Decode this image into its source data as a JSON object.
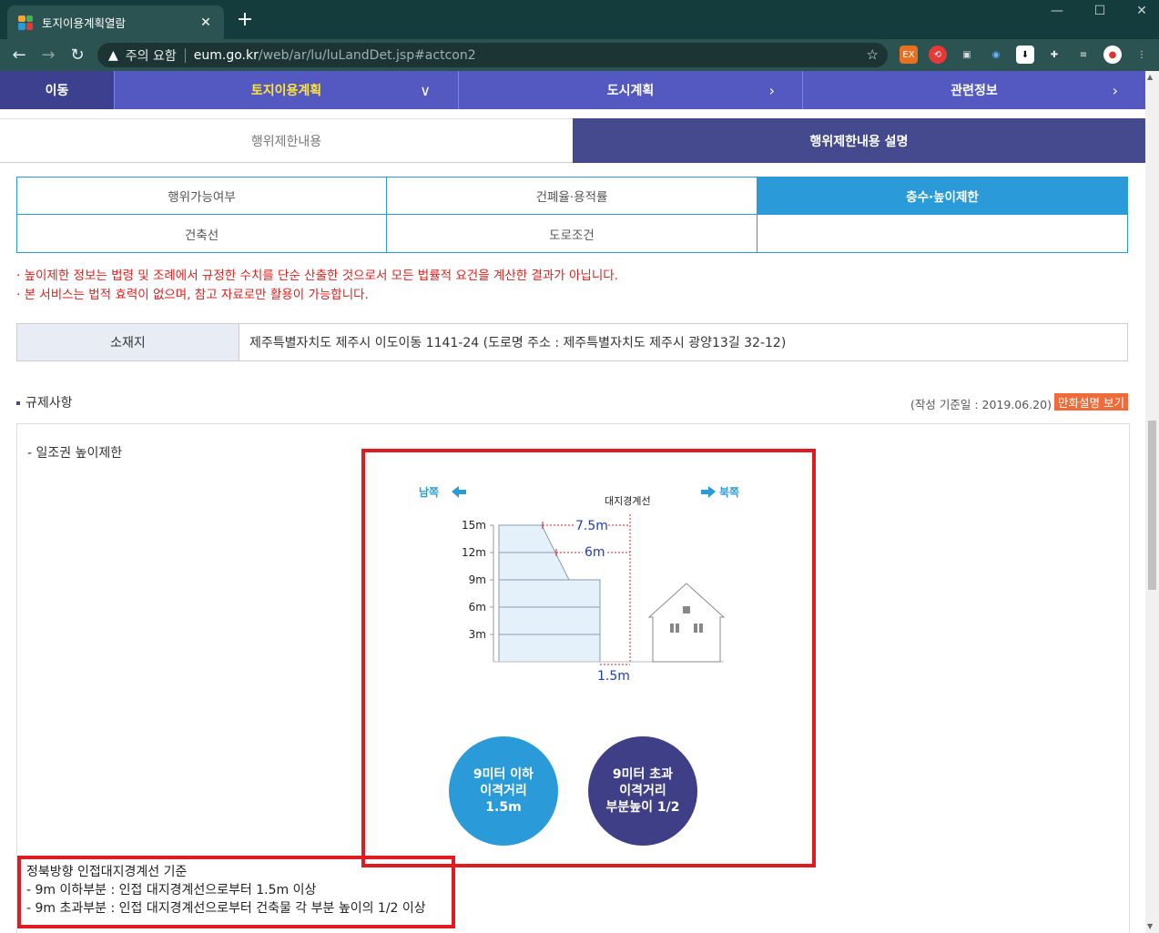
{
  "browser": {
    "tab_title": "토지이용계획열람",
    "tab_close": "✕",
    "new_tab": "+",
    "window_controls": {
      "minimize": "—",
      "maximize": "☐",
      "close": "✕"
    },
    "nav": {
      "back": "←",
      "forward": "→",
      "reload": "↻"
    },
    "security_label": "주의 요함",
    "url_host": "eum.go.kr",
    "url_path": "/web/ar/lu/luLandDet.jsp#actcon2",
    "bookmark": "☆",
    "extensions": [
      "EX",
      "⟲",
      "▣",
      "◉",
      "⬇",
      "✚",
      "≡",
      "●",
      "⋮"
    ]
  },
  "site_nav": {
    "move": "이동",
    "items": [
      {
        "label": "토지이용계획",
        "chevron": "∨"
      },
      {
        "label": "도시계획",
        "chevron": "›"
      },
      {
        "label": "관련정보",
        "chevron": "›"
      }
    ]
  },
  "main_tabs": [
    "행위제한내용",
    "행위제한내용 설명"
  ],
  "sub_tabs": [
    "행위가능여부",
    "건폐율·용적률",
    "층수·높이제한",
    "건축선",
    "도로조건",
    ""
  ],
  "notices": [
    "· 높이제한 정보는 법령 및 조례에서 규정한 수치를 단순 산출한 것으로서 모든 법률적 요건을 계산한 결과가 아닙니다.",
    "· 본 서비스는 법적 효력이 없으며, 참고 자료로만 활용이 가능합니다."
  ],
  "location": {
    "label": "소재지",
    "value": "제주특별자치도 제주시 이도이동 1141-24 (도로명 주소 : 제주특별자치도 제주시 광양13길 32-12)"
  },
  "regulation": {
    "title": "규제사항",
    "base_date": "(작성 기준일 : 2019.06.20)",
    "cartoon_button": "만화설명 보기",
    "subheading": "- 일조권 높이제한"
  },
  "diagram": {
    "south": "남쪽",
    "north": "북쪽",
    "boundary": "대지경계선",
    "y_ticks": [
      "15m",
      "12m",
      "9m",
      "6m",
      "3m"
    ],
    "dist_15": "7.5m",
    "dist_12": "6m",
    "dist_base": "1.5m"
  },
  "circles": {
    "left": [
      "9미터 이하",
      "이격거리",
      "1.5m"
    ],
    "right": [
      "9미터 초과",
      "이격거리",
      "부분높이 1/2"
    ]
  },
  "criteria": {
    "title": "정북방향 인접대지경계선 기준",
    "lines": [
      "- 9m 이하부분 : 인접 대지경계선으로부터 1.5m 이상",
      "- 9m 초과부분 : 인접 대지경계선으로부터 건축물 각 부분 높이의 1/2 이상"
    ]
  },
  "colors": {
    "nav_bg": "#5359c0",
    "active_tab": "#454a8f",
    "sub_active": "#2a9bd8",
    "notice": "#e0201c",
    "highlight_box": "#e11b22",
    "circle_left": "#2a9bd8",
    "circle_right": "#3e3f86"
  }
}
